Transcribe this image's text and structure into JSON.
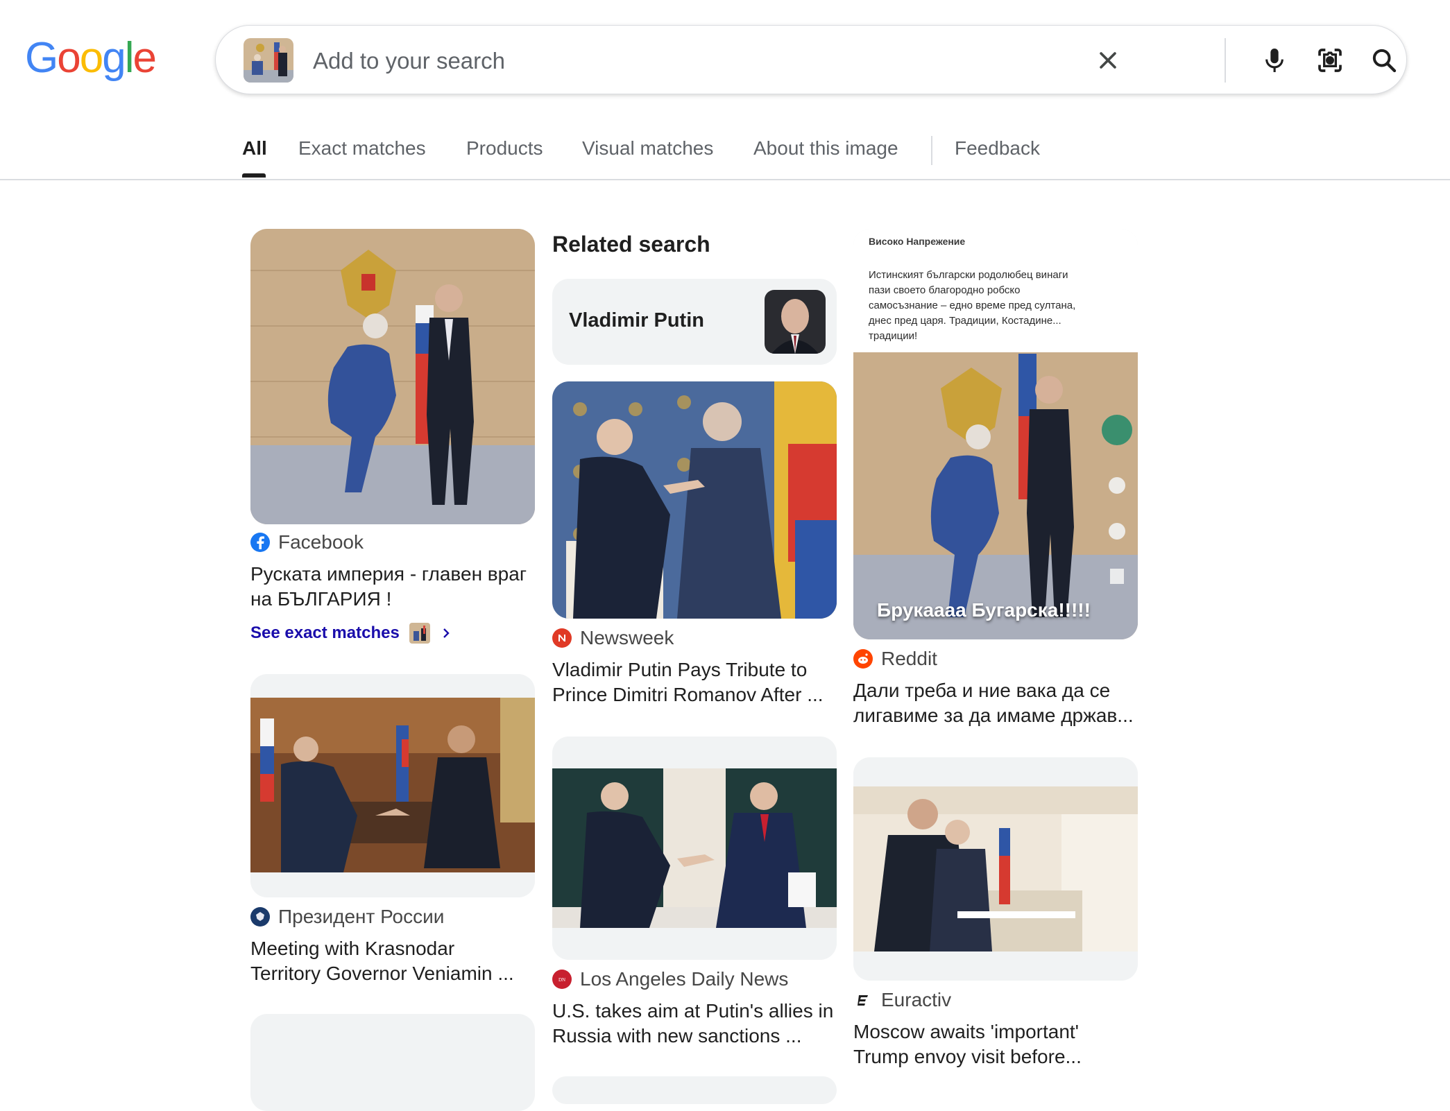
{
  "logo": {
    "letters": [
      "G",
      "o",
      "o",
      "g",
      "l",
      "e"
    ],
    "colors": [
      "#4285F4",
      "#EA4335",
      "#FBBC05",
      "#4285F4",
      "#34A853",
      "#EA4335"
    ]
  },
  "search": {
    "placeholder": "Add to your search",
    "value": ""
  },
  "search_icons": {
    "clear": "close-icon",
    "voice": "microphone-icon",
    "lens": "camera-lens-icon",
    "submit": "search-icon"
  },
  "tabs": [
    {
      "label": "All",
      "active": true
    },
    {
      "label": "Exact matches"
    },
    {
      "label": "Products"
    },
    {
      "label": "Visual matches"
    },
    {
      "label": "About this image"
    },
    {
      "label": "Feedback"
    }
  ],
  "related": {
    "heading": "Related search",
    "chip_label": "Vladimir Putin"
  },
  "results": [
    {
      "source": "Facebook",
      "title_lines": [
        "Руската империя - главен враг",
        "на БЪЛГАРИЯ !"
      ],
      "link": "See exact matches",
      "favicon_color": "#1877F2"
    },
    {
      "source": "Президент России",
      "title_lines": [
        "Meeting with Krasnodar",
        "Territory Governor Veniamin ..."
      ],
      "favicon_color": "#1a3a6b"
    },
    {
      "source": "Newsweek",
      "title_lines": [
        "Vladimir Putin Pays Tribute to",
        "Prince Dimitri Romanov After ..."
      ],
      "favicon_color": "#e03a26"
    },
    {
      "source": "Los Angeles Daily News",
      "title_lines": [
        "U.S. takes aim at Putin's allies in",
        "Russia with new sanctions ..."
      ],
      "favicon_color": "#c8202f"
    },
    {
      "source": "Reddit",
      "title_lines": [
        "Дали треба и ние вака да се",
        "лигавиме за да имаме држав..."
      ],
      "favicon_color": "#ff4500"
    },
    {
      "source": "Euractiv",
      "title_lines": [
        "Moscow awaits 'important'",
        "Trump envoy visit before..."
      ],
      "favicon_color": "#1f1f1f"
    }
  ],
  "overlay_texts": {
    "post_author": "Високо Напрежение",
    "post_body_lines": [
      "Истинският български родолюбец винаги",
      "пази своето благородно робско",
      "самосъзнание – едно време пред султана,",
      "днес пред царя. Традиции, Костадине...",
      "традиции!"
    ],
    "caption": "Брукаааа Бугарска!!!!!"
  }
}
